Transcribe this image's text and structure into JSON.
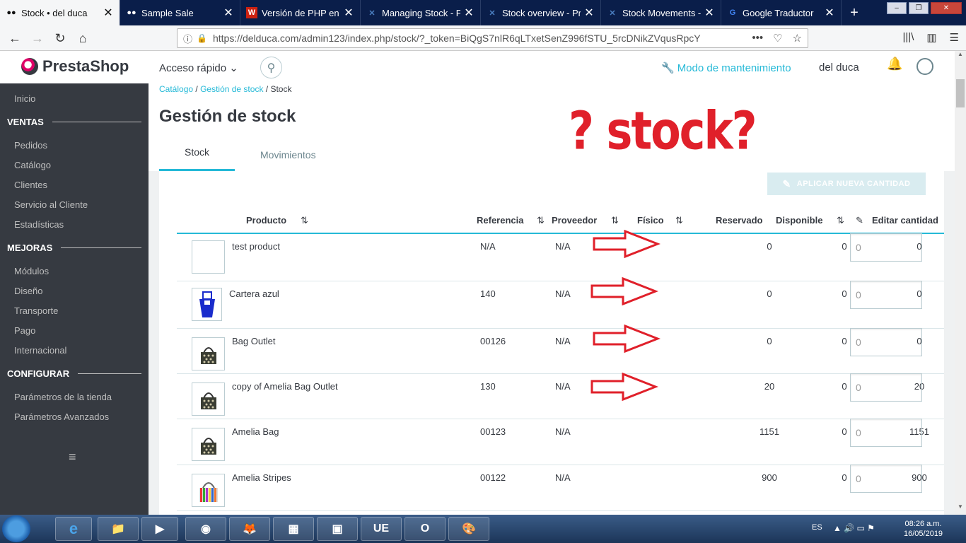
{
  "browser": {
    "tabs": [
      {
        "label": "Stock • del duca",
        "icon": "prestashop-icon",
        "active": true
      },
      {
        "label": "Sample Sale",
        "icon": "flickr-icon",
        "active": false
      },
      {
        "label": "Versión de PHP en tu",
        "icon": "php-site-icon",
        "active": false
      },
      {
        "label": "Managing Stock - Pr",
        "icon": "prestashop-doc-icon",
        "active": false
      },
      {
        "label": "Stock overview - Pres",
        "icon": "prestashop-doc-icon",
        "active": false
      },
      {
        "label": "Stock Movements - I",
        "icon": "prestashop-doc-icon",
        "active": false
      },
      {
        "label": "Google Traductor",
        "icon": "google-translate-icon",
        "active": false
      }
    ],
    "new_tab": "+",
    "url_host": "https://delduca.com",
    "url_path": "/admin123/index.php/stock/?_token=BiQgS7nlR6qLTxetSenZ996fSTU_5rcDNikZVqusRpcY",
    "url_tools": [
      "•••",
      "♡",
      "☆"
    ]
  },
  "header": {
    "logo_text": "PrestaShop",
    "quick_access": "Acceso rápido",
    "maintenance": "Modo de mantenimiento",
    "shop_name": "del duca"
  },
  "sidebar": {
    "home": "Inicio",
    "sections": [
      {
        "title": "VENTAS",
        "items": [
          "Pedidos",
          "Catálogo",
          "Clientes",
          "Servicio al Cliente",
          "Estadísticas"
        ]
      },
      {
        "title": "MEJORAS",
        "items": [
          "Módulos",
          "Diseño",
          "Transporte",
          "Pago",
          "Internacional"
        ]
      },
      {
        "title": "CONFIGURAR",
        "items": [
          "Parámetros de la tienda",
          "Parámetros Avanzados"
        ]
      }
    ]
  },
  "page": {
    "breadcrumb": [
      "Catálogo",
      "Gestión de stock",
      "Stock"
    ],
    "title": "Gestión de stock",
    "annotation": "? stock?",
    "tabs": [
      "Stock",
      "Movimientos"
    ],
    "apply_button": "APLICAR NUEVA CANTIDAD"
  },
  "table": {
    "columns": {
      "product": "Producto",
      "reference": "Referencia",
      "supplier": "Proveedor",
      "physical": "Físico",
      "reserved": "Reservado",
      "available": "Disponible",
      "edit": "Editar cantidad"
    },
    "rows": [
      {
        "name": "test product",
        "reference": "N/A",
        "supplier": "N/A",
        "physical": "0",
        "reserved": "0",
        "available": "0",
        "qty": "0",
        "thumb": "empty",
        "arrow": true
      },
      {
        "name": "Cartera azul",
        "reference": "140",
        "supplier": "N/A",
        "physical": "0",
        "reserved": "0",
        "available": "0",
        "qty": "0",
        "thumb": "blue-bag",
        "arrow": true
      },
      {
        "name": "Bag Outlet",
        "reference": "00126",
        "supplier": "N/A",
        "physical": "0",
        "reserved": "0",
        "available": "0",
        "qty": "0",
        "thumb": "dark-bag",
        "arrow": true
      },
      {
        "name": "copy of Amelia Bag Outlet",
        "reference": "130",
        "supplier": "N/A",
        "physical": "20",
        "reserved": "0",
        "available": "20",
        "qty": "0",
        "thumb": "dark-bag",
        "arrow": true
      },
      {
        "name": "Amelia Bag",
        "reference": "00123",
        "supplier": "N/A",
        "physical": "1151",
        "reserved": "0",
        "available": "1151",
        "qty": "0",
        "thumb": "dark-bag",
        "arrow": false
      },
      {
        "name": "Amelia Stripes",
        "reference": "00122",
        "supplier": "N/A",
        "physical": "900",
        "reserved": "0",
        "available": "900",
        "qty": "0",
        "thumb": "striped-bag",
        "arrow": false
      }
    ]
  },
  "taskbar": {
    "lang": "ES",
    "time": "08:26 a.m.",
    "date": "16/05/2019"
  },
  "colors": {
    "accent": "#25b9d7",
    "sidebar": "#363a41",
    "annotation": "#e0202a"
  }
}
